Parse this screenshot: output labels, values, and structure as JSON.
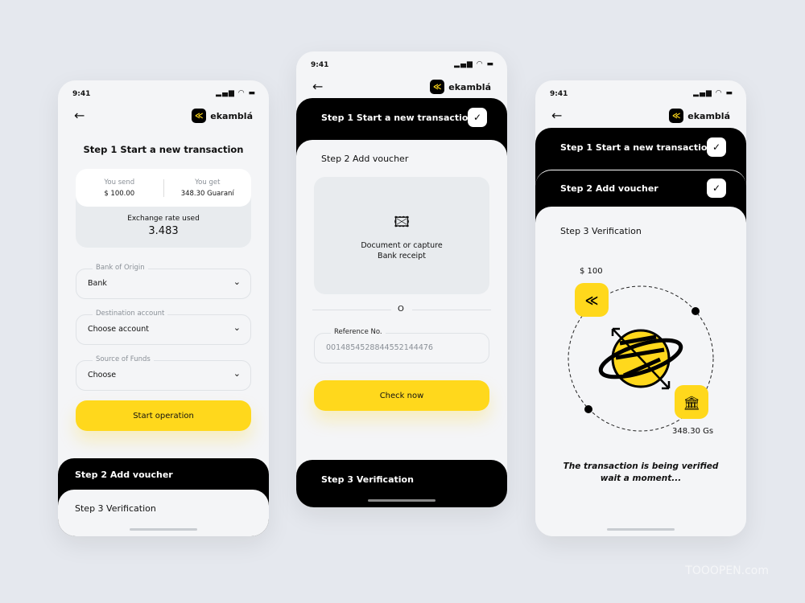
{
  "status": {
    "time": "9:41",
    "icons": "signal wifi battery"
  },
  "brand": {
    "name": "ekamblá",
    "icon": "ekambla-logo"
  },
  "screen1": {
    "title": "Step 1 Start a new transaction",
    "send_label": "You send",
    "send_value": "$ 100.00",
    "get_label": "You get",
    "get_value": "348.30 Guaraní",
    "rate_label": "Exchange rate used",
    "rate_value": "3.483",
    "fields": [
      {
        "label": "Bank of Origin",
        "value": "Bank"
      },
      {
        "label": "Destination account",
        "value": "Choose account"
      },
      {
        "label": "Source of Funds",
        "value": "Choose"
      }
    ],
    "button": "Start operation",
    "step2": "Step 2 Add voucher",
    "step3": "Step 3 Verification"
  },
  "screen2": {
    "step1": "Step 1 Start a new transaction",
    "step2": "Step 2 Add voucher",
    "upload_line1": "Document or capture",
    "upload_line2": "Bank receipt",
    "or": "O",
    "ref_label": "Reference No.",
    "ref_value": "0014854528844552144476",
    "button": "Check now",
    "step3": "Step 3 Verification"
  },
  "screen3": {
    "step1": "Step 1 Start a new transaction",
    "step2": "Step 2 Add voucher",
    "step3": "Step 3 Verification",
    "send_amount": "$ 100",
    "get_amount": "348.30 Gs",
    "message1": "The transaction is being verified",
    "message2": "wait a moment..."
  },
  "watermark": "TOOOPEN.com",
  "colors": {
    "accent": "#ffd81c",
    "dark": "#000000",
    "background": "#e5e8ee"
  }
}
